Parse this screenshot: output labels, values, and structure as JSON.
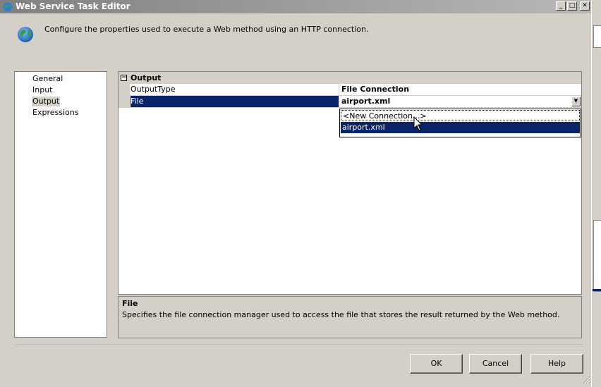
{
  "window": {
    "title": "Web Service Task Editor",
    "minimize": "_",
    "maximize": "□",
    "close": "✕"
  },
  "header": {
    "description": "Configure the properties used to execute a Web method using an HTTP connection.",
    "icon": "globe-icon"
  },
  "nav": {
    "items": [
      {
        "label": "General"
      },
      {
        "label": "Input"
      },
      {
        "label": "Output"
      },
      {
        "label": "Expressions"
      }
    ],
    "selected": "Output"
  },
  "grid": {
    "category": "Output",
    "rows": [
      {
        "name": "OutputType",
        "value": "File Connection"
      },
      {
        "name": "File",
        "value": "airport.xml"
      }
    ]
  },
  "dropdown": {
    "options": [
      "<New Connection...>",
      "airport.xml"
    ],
    "selected": "airport.xml"
  },
  "description_panel": {
    "title": "File",
    "text": "Specifies the file connection manager used to access the file that stores the result returned by the Web method."
  },
  "buttons": {
    "ok": "OK",
    "cancel": "Cancel",
    "help": "Help"
  },
  "colors": {
    "selection": "#0a246a",
    "face": "#d4d0c8"
  }
}
